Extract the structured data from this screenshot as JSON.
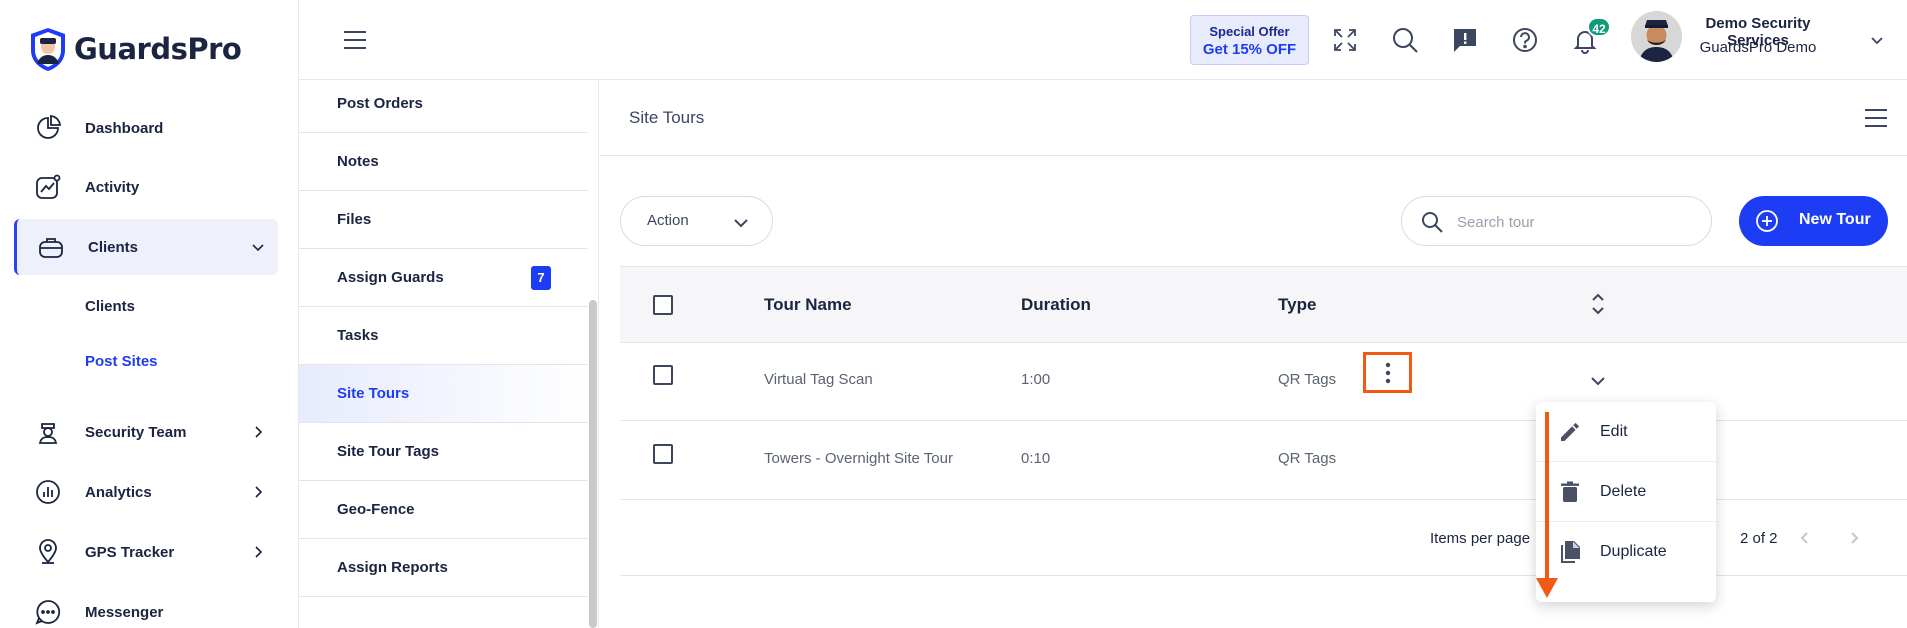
{
  "brand": {
    "name": "GuardsPro"
  },
  "sidebar": {
    "items": [
      {
        "label": "Dashboard",
        "icon": "pie-chart-icon"
      },
      {
        "label": "Activity",
        "icon": "activity-chart-icon"
      },
      {
        "label": "Clients",
        "icon": "briefcase-icon",
        "expanded": true
      },
      {
        "label": "Security Team",
        "icon": "guard-icon"
      },
      {
        "label": "Analytics",
        "icon": "analytics-icon"
      },
      {
        "label": "GPS Tracker",
        "icon": "map-pin-icon"
      },
      {
        "label": "Messenger",
        "icon": "chat-icon"
      }
    ],
    "sub_items": [
      {
        "label": "Clients"
      },
      {
        "label": "Post Sites"
      }
    ]
  },
  "topbar": {
    "offer_line1": "Special Offer",
    "offer_line2": "Get 15% OFF",
    "notification_count": "42",
    "user_name": "Demo Security Services",
    "user_org": "GuardsPro Demo"
  },
  "submenu": {
    "items": [
      {
        "label": "Post Orders"
      },
      {
        "label": "Notes"
      },
      {
        "label": "Files"
      },
      {
        "label": "Assign Guards",
        "count": "7"
      },
      {
        "label": "Tasks"
      },
      {
        "label": "Site Tours"
      },
      {
        "label": "Site Tour Tags"
      },
      {
        "label": "Geo-Fence"
      },
      {
        "label": "Assign Reports"
      }
    ]
  },
  "main": {
    "title": "Site Tours",
    "action_label": "Action",
    "search_placeholder": "Search tour",
    "new_button_label": "New Tour",
    "columns": {
      "name": "Tour Name",
      "duration": "Duration",
      "type": "Type"
    },
    "rows": [
      {
        "name": "Virtual Tag Scan",
        "duration": "1:00",
        "type": "QR Tags"
      },
      {
        "name": "Towers - Overnight Site Tour",
        "duration": "0:10",
        "type": "QR Tags"
      }
    ],
    "footer": {
      "items_per_page": "Items per page",
      "range": "2 of 2"
    }
  },
  "dropdown": {
    "items": [
      {
        "label": "Edit",
        "icon": "pencil-icon"
      },
      {
        "label": "Delete",
        "icon": "trash-icon"
      },
      {
        "label": "Duplicate",
        "icon": "duplicate-icon"
      }
    ]
  },
  "colors": {
    "accent": "#1d3df5",
    "highlight": "#f05a14",
    "badge": "#0f9a7a"
  }
}
